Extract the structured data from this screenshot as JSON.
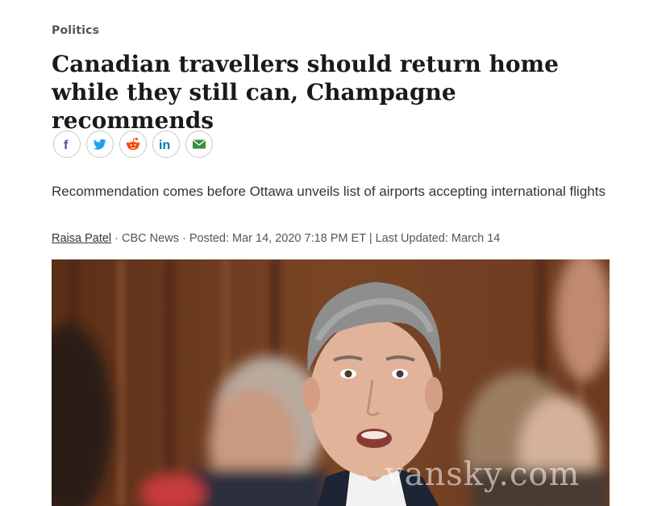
{
  "article": {
    "category": "Politics",
    "headline": "Canadian travellers should return home while they still can, Champagne recommends",
    "dek": "Recommendation comes before Ottawa unveils list of airports accepting international flights",
    "byline": {
      "author": "Raisa Patel",
      "source": " · CBC News · Posted: Mar 14, 2020 7:18 PM ET | Last Updated: March 14"
    }
  },
  "share_buttons": [
    {
      "name": "facebook",
      "icon": "facebook-icon",
      "color": "#3b5998"
    },
    {
      "name": "twitter",
      "icon": "twitter-icon",
      "color": "#1da1f2"
    },
    {
      "name": "reddit",
      "icon": "reddit-icon",
      "color": "#ff4500"
    },
    {
      "name": "linkedin",
      "icon": "linkedin-icon",
      "color": "#0077b5"
    },
    {
      "name": "email",
      "icon": "email-icon",
      "color": "#3a8f3a"
    }
  ],
  "watermark": "vansky.com"
}
